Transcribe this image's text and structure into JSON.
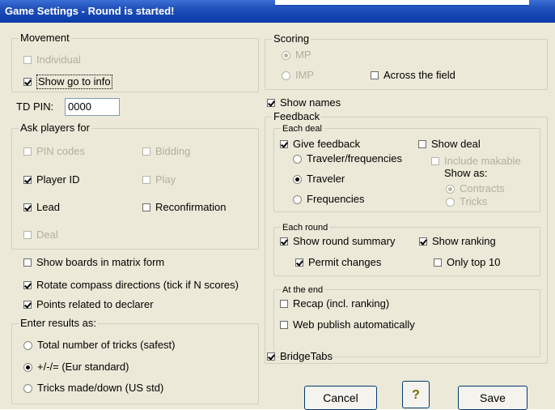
{
  "window": {
    "title": "Game Settings - Round is started!"
  },
  "movement": {
    "legend": "Movement",
    "individual": {
      "label": "Individual",
      "checked": false,
      "disabled": true
    },
    "show_go_to_info": {
      "label": "Show go to info",
      "checked": true
    }
  },
  "td_pin": {
    "label": "TD PIN:",
    "value": "0000"
  },
  "ask_players": {
    "legend": "Ask players for",
    "pin_codes": {
      "label": "PIN codes",
      "checked": false,
      "disabled": true
    },
    "bidding": {
      "label": "Bidding",
      "checked": false,
      "disabled": true
    },
    "player_id": {
      "label": "Player ID",
      "checked": true
    },
    "play": {
      "label": "Play",
      "checked": false,
      "disabled": true
    },
    "lead": {
      "label": "Lead",
      "checked": true
    },
    "reconfirmation": {
      "label": "Reconfirmation",
      "checked": false
    },
    "deal": {
      "label": "Deal",
      "checked": false,
      "disabled": true
    }
  },
  "options": {
    "show_boards_matrix": {
      "label": "Show boards in matrix form",
      "checked": false
    },
    "rotate_compass": {
      "label": "Rotate compass directions (tick if N scores)",
      "checked": true
    },
    "points_declarer": {
      "label": "Points related to declarer",
      "checked": true
    }
  },
  "enter_results": {
    "legend": "Enter results as:",
    "total_tricks": {
      "label": "Total number of tricks (safest)",
      "selected": false
    },
    "plus_minus": {
      "label": "+/-/= (Eur standard)",
      "selected": true
    },
    "tricks_made_down": {
      "label": "Tricks made/down (US std)",
      "selected": false
    }
  },
  "scoring": {
    "legend": "Scoring",
    "mp": {
      "label": "MP",
      "selected": true,
      "disabled": true
    },
    "imp": {
      "label": "IMP",
      "selected": false,
      "disabled": true
    },
    "across_field": {
      "label": "Across the field",
      "checked": false
    }
  },
  "show_names": {
    "label": "Show names",
    "checked": true
  },
  "feedback": {
    "legend": "Feedback",
    "each_deal": {
      "legend": "Each deal",
      "give_feedback": {
        "label": "Give feedback",
        "checked": true
      },
      "show_deal": {
        "label": "Show deal",
        "checked": false
      },
      "traveler_frequencies": {
        "label": "Traveler/frequencies",
        "selected": false
      },
      "include_makable": {
        "label": "Include makable",
        "checked": false,
        "disabled": true
      },
      "traveler": {
        "label": "Traveler",
        "selected": true
      },
      "show_as_label": "Show as:",
      "contracts": {
        "label": "Contracts",
        "selected": true,
        "disabled": true
      },
      "frequencies": {
        "label": "Frequencies",
        "selected": false
      },
      "tricks": {
        "label": "Tricks",
        "selected": false,
        "disabled": true
      }
    },
    "each_round": {
      "legend": "Each round",
      "show_round_summary": {
        "label": "Show round summary",
        "checked": true
      },
      "show_ranking": {
        "label": "Show ranking",
        "checked": true
      },
      "permit_changes": {
        "label": "Permit changes",
        "checked": true
      },
      "only_top_10": {
        "label": "Only top 10",
        "checked": false
      }
    },
    "at_the_end": {
      "legend": "At the end",
      "recap": {
        "label": "Recap (incl. ranking)",
        "checked": false
      },
      "web_publish": {
        "label": "Web publish automatically",
        "checked": false
      }
    }
  },
  "bridgetabs": {
    "label": "BridgeTabs",
    "checked": true
  },
  "buttons": {
    "cancel": "Cancel",
    "help_icon": "question-mark-icon",
    "save": "Save"
  },
  "colors": {
    "title_bar": "#1f4fb8",
    "dialog_bg": "#ece9d8",
    "disabled_text": "#b0b0a0"
  }
}
